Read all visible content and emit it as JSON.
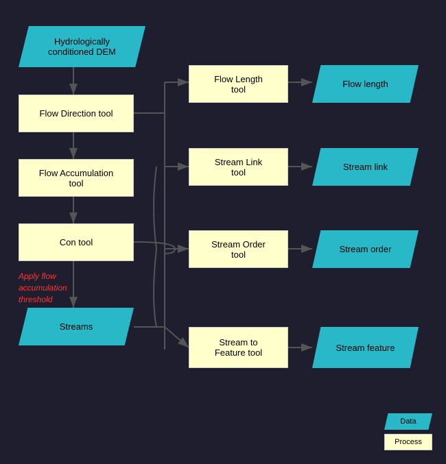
{
  "shapes": {
    "hydro_dem": {
      "label": "Hydrologically\nconditioned DEM",
      "type": "data"
    },
    "flow_direction": {
      "label": "Flow Direction tool",
      "type": "process"
    },
    "flow_accumulation": {
      "label": "Flow Accumulation\ntool",
      "type": "process"
    },
    "con_tool": {
      "label": "Con tool",
      "type": "process"
    },
    "streams": {
      "label": "Streams",
      "type": "data"
    },
    "flow_length_tool": {
      "label": "Flow Length\ntool",
      "type": "process"
    },
    "stream_link_tool": {
      "label": "Stream Link\ntool",
      "type": "process"
    },
    "stream_order_tool": {
      "label": "Stream Order\ntool",
      "type": "process"
    },
    "stream_to_feature_tool": {
      "label": "Stream to\nFeature tool",
      "type": "process"
    },
    "flow_length_out": {
      "label": "Flow length",
      "type": "data"
    },
    "stream_link_out": {
      "label": "Stream link",
      "type": "data"
    },
    "stream_order_out": {
      "label": "Stream order",
      "type": "data"
    },
    "stream_feature_out": {
      "label": "Stream feature",
      "type": "data"
    }
  },
  "annotation": {
    "text": "Apply flow\naccumulation\nthreshold",
    "color": "#ff4444"
  },
  "legend": {
    "data_label": "Data",
    "process_label": "Process"
  }
}
